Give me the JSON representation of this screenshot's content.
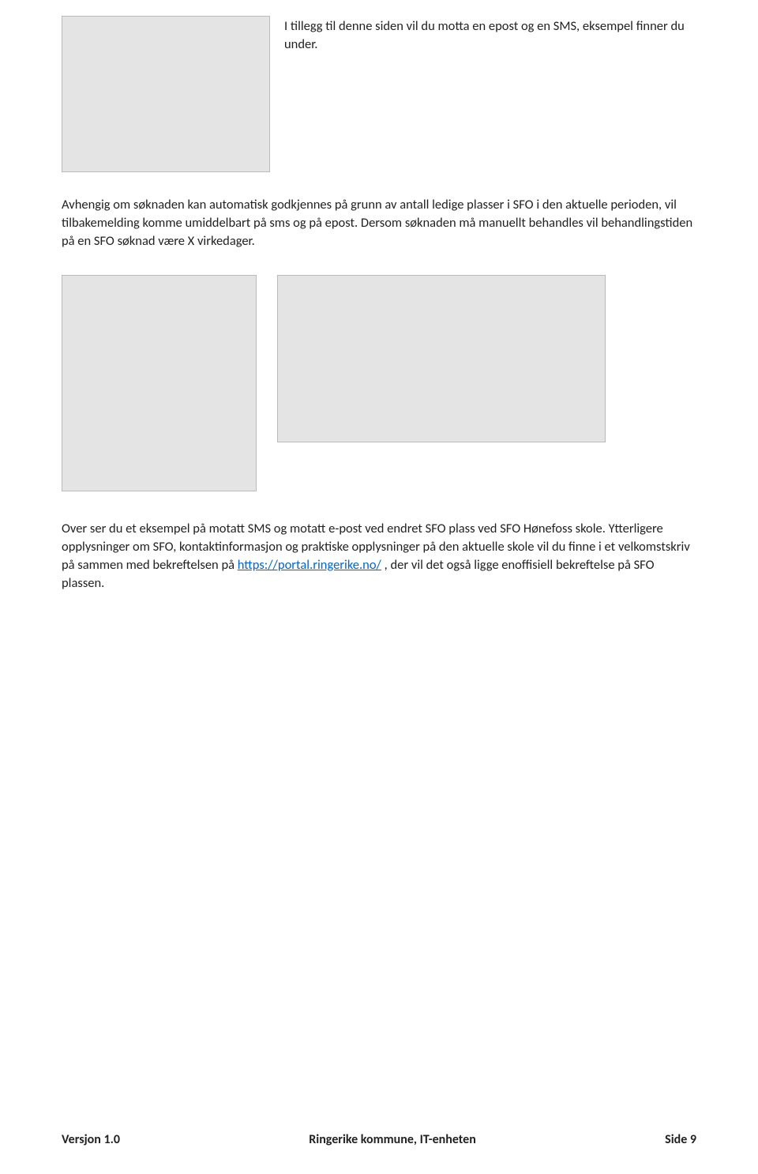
{
  "top_paragraph": "I tillegg til denne siden vil du motta en epost og en SMS, eksempel finner du under.",
  "para2": "Avhengig om søknaden kan automatisk godkjennes på grunn av antall ledige plasser i SFO i den aktuelle perioden, vil tilbakemelding komme umiddelbart på sms og på epost. Dersom søknaden må manuellt behandles vil behandlingstiden på en SFO søknad være X virkedager.",
  "para3_part1": "Over ser du et eksempel på motatt SMS og motatt e-post ved endret SFO plass ved SFO Hønefoss skole. Ytterligere opplysninger om SFO, kontaktinformasjon og praktiske opplysninger på den aktuelle skole vil du finne i et velkomstskriv på sammen med bekreftelsen på ",
  "para3_link_text": "https://portal.ringerike.no/",
  "para3_part2": " , der vil det også ligge enoffisiell bekreftelse på SFO plassen.",
  "footer": {
    "left": "Versjon 1.0",
    "center": "Ringerike kommune, IT-enheten",
    "right": "Side 9"
  }
}
